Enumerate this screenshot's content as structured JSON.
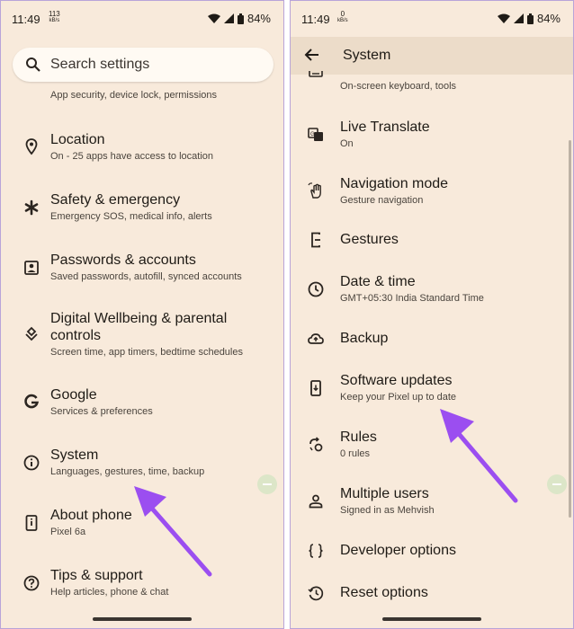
{
  "left_screen": {
    "status": {
      "time": "11:49",
      "net_speed": "113",
      "net_unit": "kB/s",
      "battery": "84%"
    },
    "search": {
      "placeholder": "Search settings"
    },
    "partial_sub": "App security, device lock, permissions",
    "items": [
      {
        "title": "Location",
        "sub": "On - 25 apps have access to location",
        "icon": "location-pin-icon"
      },
      {
        "title": "Safety & emergency",
        "sub": "Emergency SOS, medical info, alerts",
        "icon": "asterisk-icon"
      },
      {
        "title": "Passwords & accounts",
        "sub": "Saved passwords, autofill, synced accounts",
        "icon": "account-box-icon"
      },
      {
        "title": "Digital Wellbeing & parental controls",
        "sub": "Screen time, app timers, bedtime schedules",
        "icon": "wellbeing-icon"
      },
      {
        "title": "Google",
        "sub": "Services & preferences",
        "icon": "google-g-icon"
      },
      {
        "title": "System",
        "sub": "Languages, gestures, time, backup",
        "icon": "info-icon"
      },
      {
        "title": "About phone",
        "sub": "Pixel 6a",
        "icon": "phone-info-icon"
      },
      {
        "title": "Tips & support",
        "sub": "Help articles, phone & chat",
        "icon": "help-icon"
      }
    ]
  },
  "right_screen": {
    "status": {
      "time": "11:49",
      "net_speed": "0",
      "net_unit": "kB/s",
      "battery": "84%"
    },
    "header": {
      "title": "System"
    },
    "partial_sub": "On-screen keyboard, tools",
    "items": [
      {
        "title": "Live Translate",
        "sub": "On",
        "icon": "translate-icon"
      },
      {
        "title": "Navigation mode",
        "sub": "Gesture navigation",
        "icon": "gesture-hand-icon"
      },
      {
        "title": "Gestures",
        "sub": "",
        "icon": "phone-gesture-icon"
      },
      {
        "title": "Date & time",
        "sub": "GMT+05:30 India Standard Time",
        "icon": "clock-icon"
      },
      {
        "title": "Backup",
        "sub": "",
        "icon": "cloud-upload-icon"
      },
      {
        "title": "Software updates",
        "sub": "Keep your Pixel up to date",
        "icon": "system-update-icon"
      },
      {
        "title": "Rules",
        "sub": "0 rules",
        "icon": "rules-icon"
      },
      {
        "title": "Multiple users",
        "sub": "Signed in as Mehvish",
        "icon": "person-icon"
      },
      {
        "title": "Developer options",
        "sub": "",
        "icon": "braces-icon"
      },
      {
        "title": "Reset options",
        "sub": "",
        "icon": "history-icon"
      }
    ]
  },
  "colors": {
    "background": "#f8eadb",
    "header": "#ecdcc9",
    "arrow": "#9b4ef0",
    "border": "#b9a4d9"
  }
}
